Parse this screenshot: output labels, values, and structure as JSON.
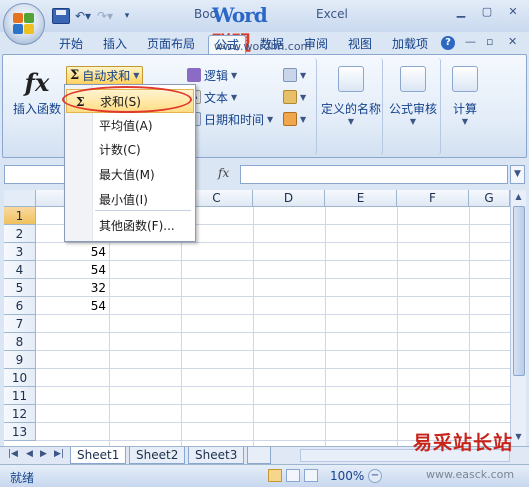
{
  "window": {
    "title_prefix": "Boo",
    "title_suffix": "Excel",
    "watermark_word": "Word",
    "watermark_cn": "联盟",
    "watermark_url": "www.wordlm.com"
  },
  "tabs": [
    "开始",
    "插入",
    "页面布局",
    "公式",
    "数据",
    "审阅",
    "视图",
    "加载项"
  ],
  "active_tab": "公式",
  "ribbon": {
    "insert_function": "插入函数",
    "autosum": "自动求和",
    "logical": "逻辑",
    "text": "文本",
    "datetime": "日期和时间",
    "defined_names": "定义的名称",
    "formula_auditing": "公式审核",
    "calculation": "计算"
  },
  "formula_bar": {
    "fx": "fx",
    "name_box": "",
    "value": ""
  },
  "autosum_menu": {
    "items": [
      "求和(S)",
      "平均值(A)",
      "计数(C)",
      "最大值(M)",
      "最小值(I)",
      "其他函数(F)..."
    ],
    "highlighted_index": 0
  },
  "grid": {
    "columns": [
      "C",
      "D",
      "E",
      "F",
      "G"
    ],
    "rows": [
      "1",
      "2",
      "3",
      "4",
      "5",
      "6",
      "7",
      "8",
      "9",
      "10",
      "11",
      "12",
      "13"
    ],
    "selected_row": "1",
    "cells_B": [
      "",
      "",
      "54",
      "54",
      "32",
      "54",
      "",
      "",
      "",
      "",
      "",
      "",
      ""
    ]
  },
  "sheets": [
    "Sheet1",
    "Sheet2",
    "Sheet3"
  ],
  "active_sheet": "Sheet1",
  "status": {
    "ready": "就绪",
    "zoom": "100%"
  },
  "site_watermark": {
    "name": "易采站长站",
    "url": "www.easck.com"
  },
  "colors": {
    "accent": "#15428b",
    "highlight": "#ffdd84",
    "annotation": "#e0392d"
  }
}
